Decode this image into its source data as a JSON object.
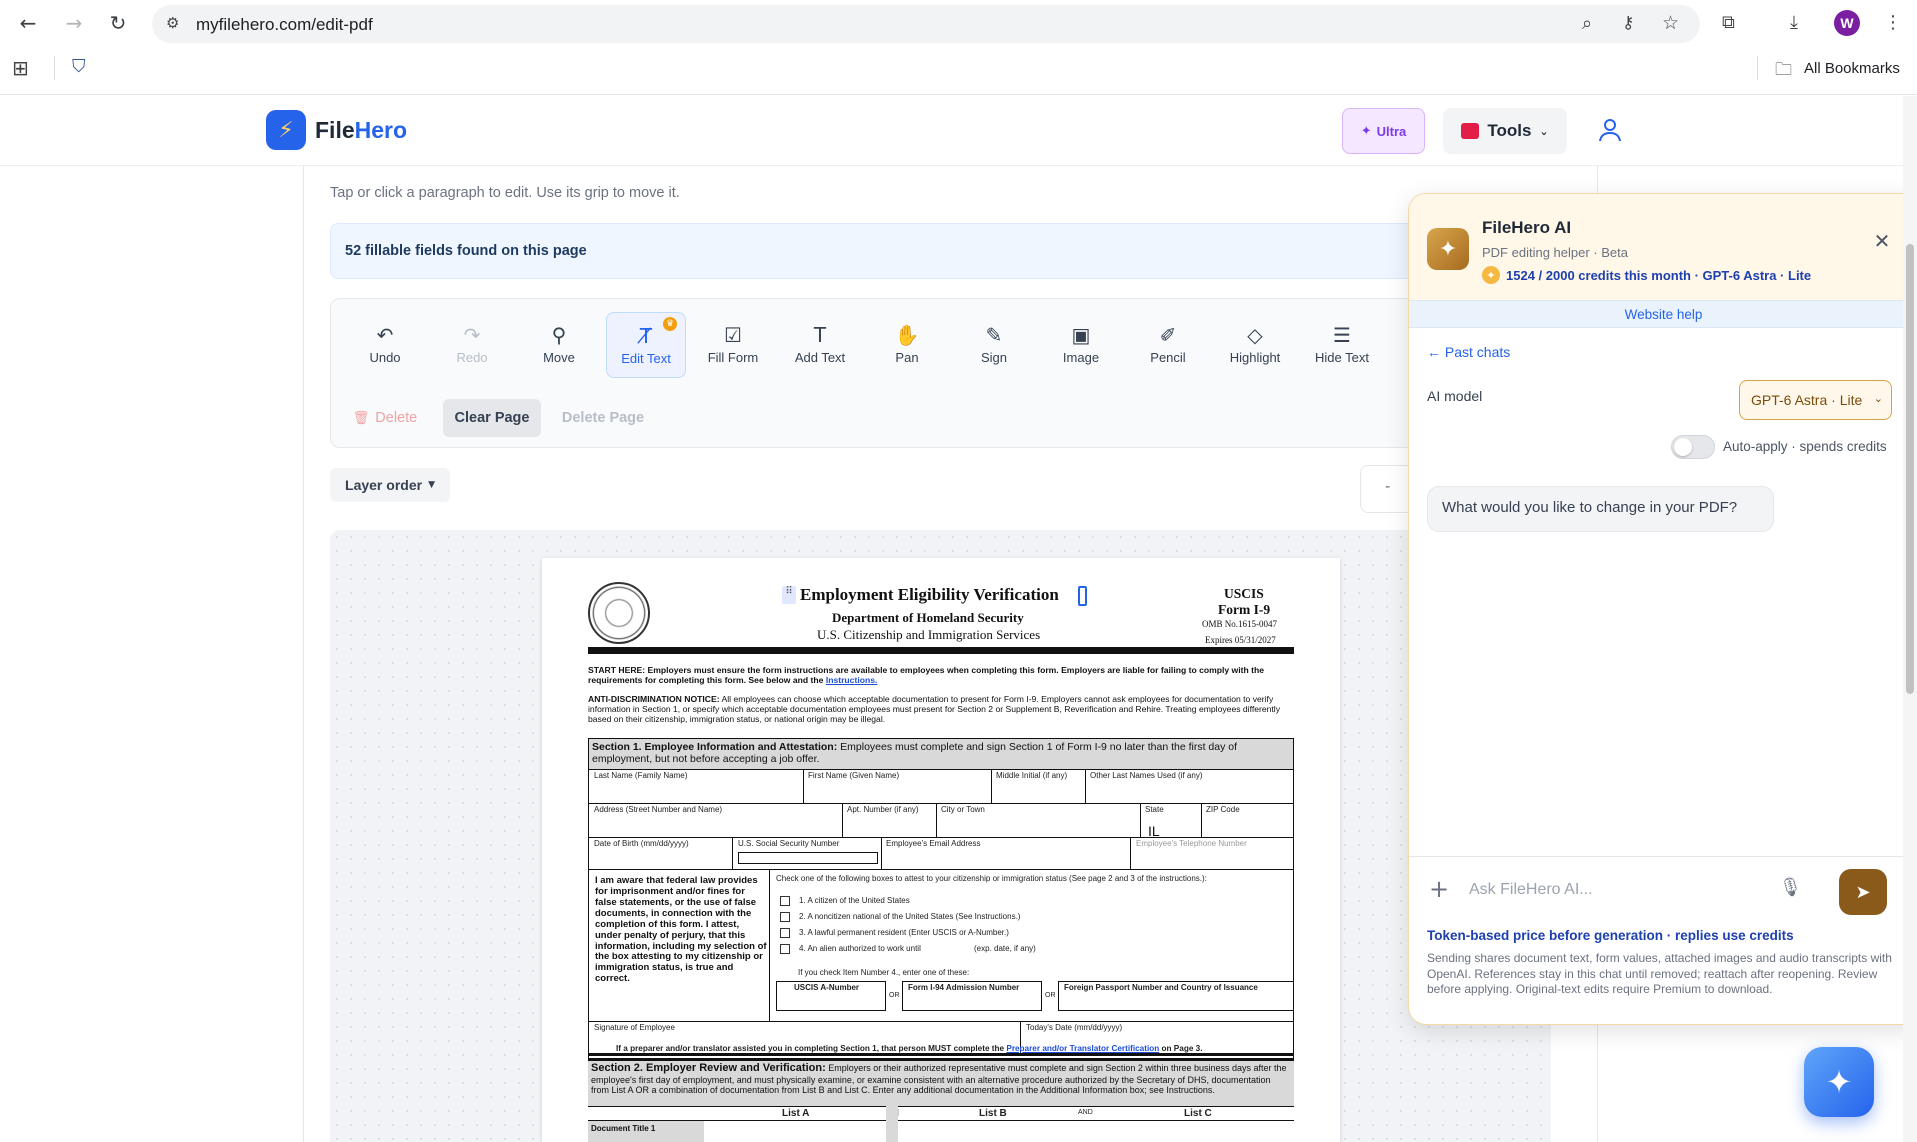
{
  "browser": {
    "url": "myfilehero.com/edit-pdf",
    "avatar_letter": "W",
    "bookmarks_label": "All Bookmarks",
    "icons": [
      "back-icon",
      "forward-icon",
      "reload-icon",
      "site-info-icon",
      "zoom-icon",
      "password-key-icon",
      "star-icon",
      "extensions-icon",
      "download-icon",
      "menu-dots-icon",
      "apps-grid-icon",
      "shield-extension-icon",
      "folder-icon"
    ]
  },
  "app": {
    "brand_a": "File",
    "brand_b": "Hero",
    "ultra_label": "Ultra",
    "tools_label": "Tools"
  },
  "editor": {
    "hint": "Tap or click a paragraph to edit. Use its grip to move it.",
    "fields_banner": "52 fillable fields found on this page",
    "tools": [
      {
        "label": "Undo",
        "icon": "undo-icon"
      },
      {
        "label": "Redo",
        "icon": "redo-icon"
      },
      {
        "label": "Move",
        "icon": "move-icon"
      },
      {
        "label": "Edit Text",
        "icon": "edit-text-icon"
      },
      {
        "label": "Fill Form",
        "icon": "fill-form-icon"
      },
      {
        "label": "Add Text",
        "icon": "add-text-icon"
      },
      {
        "label": "Pan",
        "icon": "hand-icon"
      },
      {
        "label": "Sign",
        "icon": "sign-icon"
      },
      {
        "label": "Image",
        "icon": "image-icon"
      },
      {
        "label": "Pencil",
        "icon": "pencil-icon"
      },
      {
        "label": "Highlight",
        "icon": "highlight-icon"
      },
      {
        "label": "Hide Text",
        "icon": "hide-text-icon"
      }
    ],
    "delete_label": "Delete",
    "clear_page_label": "Clear Page",
    "delete_page_label": "Delete Page",
    "layer_order_label": "Layer order",
    "zoom_minus": "-"
  },
  "document": {
    "title": "Employment Eligibility Verification",
    "dept": "Department of Homeland Security",
    "agency": "U.S. Citizenship and Immigration Services",
    "uscis": "USCIS",
    "form": "Form I-9",
    "omb": "OMB No.1615-0047",
    "expires": "Expires 05/31/2027",
    "start_here_bold": "START HERE:  Employers must ensure the form instructions are available to employees when completing this form.  Employers are liable for failing to comply with the requirements for completing this form.  See below and the",
    "instructions_link": "Instructions.",
    "anti_bold": "ANTI-DISCRIMINATION NOTICE:",
    "anti_text": "All employees can choose which acceptable documentation to present for Form I-9.  Employers cannot ask employees for documentation to verify information in Section 1, or specify which acceptable documentation employees must present for Section 2 or Supplement B, Reverification and Rehire.  Treating employees differently based on their citizenship, immigration status, or national origin may be illegal.",
    "sec1_bold": "Section 1. Employee Information and Attestation:",
    "sec1_text": "Employees must complete and sign Section 1 of Form I-9 no later than the first day of employment, but not before accepting a job offer.",
    "f_last": "Last Name (Family Name)",
    "f_first": "First Name (Given Name)",
    "f_mi": "Middle Initial (if any)",
    "f_other": "Other Last Names Used (if any)",
    "f_address": "Address (Street Number and Name)",
    "f_apt": "Apt. Number (if any)",
    "f_city": "City or Town",
    "f_state": "State",
    "f_zip": "ZIP Code",
    "state_value": "IL",
    "f_dob": "Date of Birth (mm/dd/yyyy)",
    "f_ssn": "U.S. Social Security Number",
    "f_email": "Employee's Email Address",
    "f_phone": "Employee's Telephone Number",
    "attest": "I am aware that federal law provides for imprisonment and/or fines for false statements, or the use of false documents, in connection with the completion of this form.  I attest, under penalty of perjury, that this information, including my selection of the box attesting to my citizenship or immigration status, is true and correct.",
    "check_intro": "Check one of the following boxes to attest to your citizenship or immigration status (See page 2 and 3 of the instructions.):",
    "opt1": "1.   A citizen of the United States",
    "opt2": "2.   A noncitizen national of the United States (See Instructions.)",
    "opt3": "3.   A lawful permanent resident (Enter USCIS or A-Number.)",
    "opt4": "4.   An alien authorized to work until",
    "opt4_exp": "(exp. date, if any)",
    "item4": "If you check Item Number 4., enter one of these:",
    "col_a": "USCIS A-Number",
    "col_or": "OR",
    "col_b": "Form I-94 Admission Number",
    "col_c": "Foreign Passport Number and Country of Issuance",
    "f_sig": "Signature of Employee",
    "f_date": "Today's Date (mm/dd/yyyy)",
    "preparer": "If a preparer and/or translator assisted you in completing Section 1, that person MUST complete the",
    "preparer_link": "Preparer and/or Translator Certification",
    "preparer_end": "on Page 3.",
    "sec2_bold": "Section 2. Employer Review and Verification:",
    "sec2_text": "Employers or their authorized representative must complete and sign Section 2 within three business days after the employee's first day of employment, and must physically examine, or examine consistent with an alternative procedure authorized by the Secretary of DHS, documentation from List A OR a combination of documentation from List B and List C.  Enter any additional documentation in the Additional Information box; see Instructions.",
    "list_a": "List A",
    "list_or": "OR",
    "list_b": "List B",
    "list_and": "AND",
    "list_c": "List C",
    "doc_title": "Document Title 1"
  },
  "ai": {
    "title": "FileHero AI",
    "subtitle": "PDF editing helper · Beta",
    "credits": "1524 / 2000 credits this month · GPT-6 Astra · Lite",
    "website_help": "Website help",
    "past_chats": "← Past chats",
    "model_label": "AI model",
    "model_value": "GPT-6 Astra · Lite",
    "auto_apply": "Auto-apply · spends credits",
    "greeting": "What would you like to change in your PDF?",
    "input_placeholder": "Ask FileHero AI...",
    "pricing": "Token-based price before generation · replies use credits",
    "disclaimer": "Sending shares document text, form values, attached images and audio transcripts with OpenAI. References stay in this chat until removed; reattach after reopening. Review before applying. Original-text edits require Premium to download."
  },
  "colors": {
    "accent": "#2563eb",
    "ai_accent": "#8a5a1a",
    "ultra": "#7c3aed"
  }
}
